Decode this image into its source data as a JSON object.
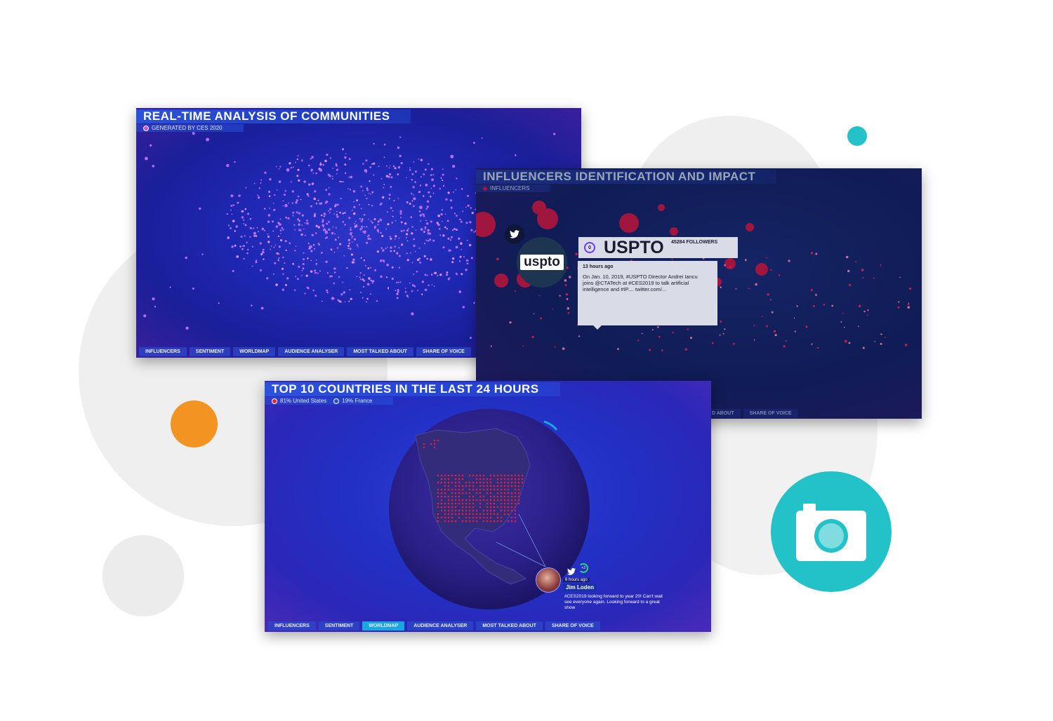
{
  "panels": {
    "communities": {
      "title": "REAL-TIME ANALYSIS OF COMMUNITIES",
      "subtitle": "GENERATED BY CES 2020",
      "nav": [
        "INFLUENCERS",
        "SENTIMENT",
        "WORLDMAP",
        "AUDIENCE ANALYSER",
        "MOST TALKED ABOUT",
        "SHARE OF VOICE"
      ]
    },
    "influencers": {
      "title": "INFLUENCERS IDENTIFICATION AND IMPACT",
      "subtitle": "INFLUENCERS",
      "profile": {
        "logo_text": "uspto",
        "name": "USPTO",
        "followers": "45284 FOLLOWERS",
        "rank": "0",
        "time_ago": "13 hours ago",
        "tweet": "On Jan. 10, 2019, #USPTO Director Andrei Iancu joins @CTATech at #CES2019 to talk artificial intelligence and #IP.... twitter.com/..."
      },
      "nav_visible": [
        "D ABOUT",
        "SHARE OF VOICE"
      ]
    },
    "worldmap": {
      "title": "TOP 10 COUNTRIES IN THE LAST 24 HOURS",
      "legend": [
        {
          "label": "81% United States",
          "color": "#e0213f"
        },
        {
          "label": "19% France",
          "color": "#2a4fd6"
        }
      ],
      "tweet": {
        "time_ago": "6 hours ago",
        "user": "Jim Loden",
        "badge": "+3",
        "text": "#CES2019 looking forward to year 20! Can't wait see everyone again. Looking forward to a great show"
      },
      "nav": [
        "INFLUENCERS",
        "SENTIMENT",
        "WORLDMAP",
        "AUDIENCE ANALYSER",
        "MOST TALKED ABOUT",
        "SHARE OF VOICE"
      ],
      "active_nav": "WORLDMAP"
    }
  },
  "colors": {
    "accent_teal": "#22c2c8",
    "accent_orange": "#f39322",
    "panel_blue": "#1f2fd0",
    "highlight_red": "#a0163e"
  },
  "icons": {
    "camera": "camera-icon",
    "twitter": "twitter-icon"
  }
}
